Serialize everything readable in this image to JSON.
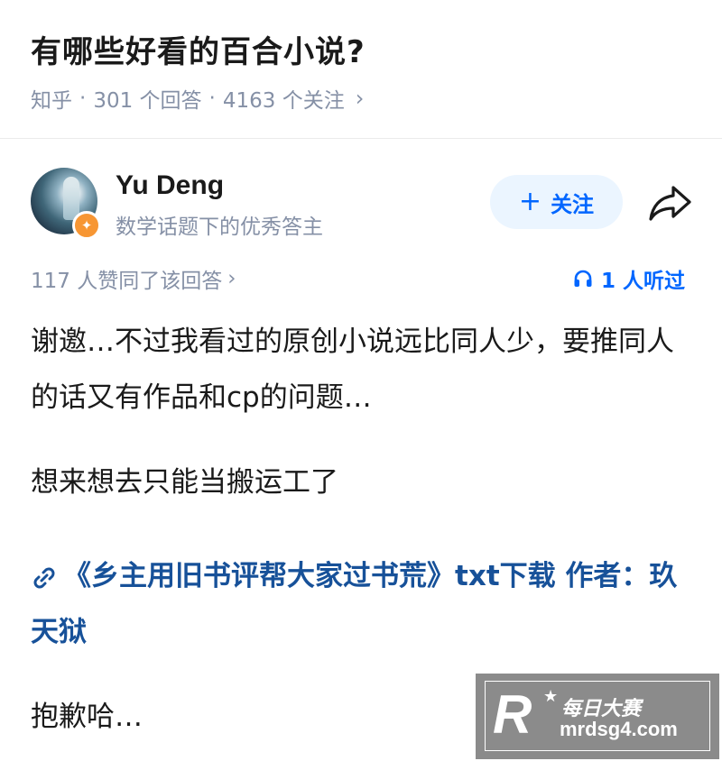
{
  "question": {
    "title": "有哪些好看的百合小说?",
    "source": "知乎",
    "answers": "301 个回答",
    "followers": "4163 个关注",
    "separator": "·",
    "chevron": "›"
  },
  "author": {
    "name": "Yu Deng",
    "description": "数学话题下的优秀答主",
    "follow_label": "关注",
    "follow_icon": "plus-icon",
    "share_icon": "share-icon"
  },
  "stats": {
    "votes": "117 人赞同了该回答",
    "listen": "1 人听过",
    "listen_icon": "headphones-icon"
  },
  "answer": {
    "paragraph1": "谢邀…不过我看过的原创小说远比同人少，要推同人的话又有作品和cp的问题…",
    "paragraph2": "想来想去只能当搬运工了",
    "link_text": "《乡主用旧书评帮大家过书荒》txt下载 作者：玖天狱",
    "link_icon": "link-icon",
    "paragraph3": "抱歉哈…"
  },
  "watermark": {
    "logo_letter": "R",
    "name": "每日大赛",
    "url": "mrdsg4.com"
  },
  "colors": {
    "accent": "#0066ff",
    "link": "#175199",
    "meta": "#8590a6",
    "badge": "#f79633"
  }
}
